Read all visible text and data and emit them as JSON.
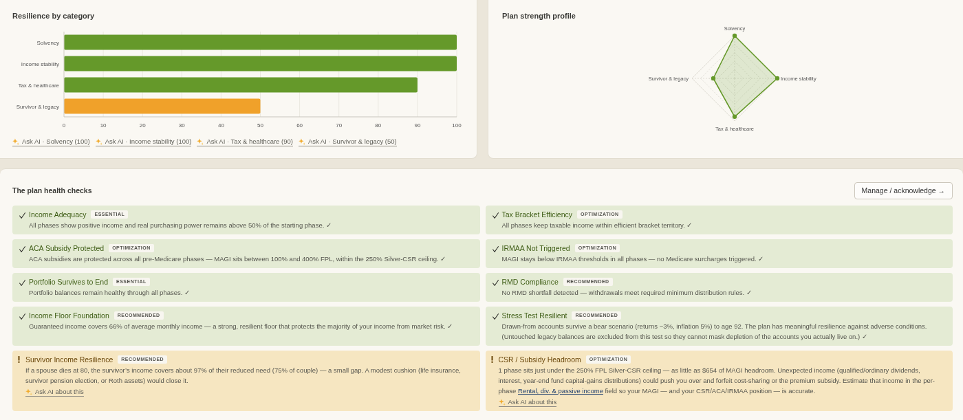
{
  "resilience_card": {
    "title": "Resilience by category",
    "chart_data": {
      "type": "bar",
      "orientation": "horizontal",
      "categories": [
        "Solvency",
        "Income stability",
        "Tax & healthcare",
        "Survivor & legacy"
      ],
      "series": [
        {
          "color": "#65992a",
          "values": [
            100,
            100,
            90,
            null
          ]
        },
        {
          "color": "#f0a12a",
          "values": [
            null,
            null,
            null,
            50
          ]
        }
      ],
      "stacked": true,
      "grid": true,
      "xlim": [
        0,
        100
      ],
      "xticks": [
        0,
        10,
        20,
        30,
        40,
        50,
        60,
        70,
        80,
        90,
        100
      ]
    },
    "ask_ai_links": [
      "Ask AI · Solvency (100)",
      "Ask AI · Income stability (100)",
      "Ask AI · Tax & healthcare (90)",
      "Ask AI · Survivor & legacy (50)"
    ]
  },
  "profile_card": {
    "title": "Plan strength profile",
    "axis_labels": [
      "Solvency",
      "Income stability",
      "Tax & healthcare",
      "Survivor & legacy"
    ]
  },
  "health_checks": {
    "title": "The plan health checks",
    "manage_button": "Manage / acknowledge →",
    "checks": [
      {
        "kind": "pass",
        "title": "Income Adequacy",
        "badge": "ESSENTIAL",
        "description": "All phases show positive income and real purchasing power remains above 50% of the starting phase. ✓"
      },
      {
        "kind": "pass",
        "title": "Tax Bracket Efficiency",
        "badge": "OPTIMIZATION",
        "description": "All phases keep taxable income within efficient bracket territory. ✓"
      },
      {
        "kind": "pass",
        "title": "ACA Subsidy Protected",
        "badge": "OPTIMIZATION",
        "description": "ACA subsidies are protected across all pre-Medicare phases — MAGI sits between 100% and 400% FPL, within the 250% Silver-CSR ceiling. ✓"
      },
      {
        "kind": "pass",
        "title": "IRMAA Not Triggered",
        "badge": "OPTIMIZATION",
        "description": "MAGI stays below IRMAA thresholds in all phases — no Medicare surcharges triggered. ✓"
      },
      {
        "kind": "pass",
        "title": "Portfolio Survives to End",
        "badge": "ESSENTIAL",
        "description": "Portfolio balances remain healthy through all phases. ✓"
      },
      {
        "kind": "pass",
        "title": "RMD Compliance",
        "badge": "RECOMMENDED",
        "description": "No RMD shortfall detected — withdrawals meet required minimum distribution rules. ✓"
      },
      {
        "kind": "pass",
        "title": "Income Floor Foundation",
        "badge": "RECOMMENDED",
        "description": "Guaranteed income covers 66% of average monthly income — a strong, resilient floor that protects the majority of your income from market risk. ✓"
      },
      {
        "kind": "pass",
        "title": "Stress Test Resilient",
        "badge": "RECOMMENDED",
        "description": "Drawn-from accounts survive a bear scenario (returns −3%, inflation 5%) to age 92. The plan has meaningful resilience against adverse conditions. (Untouched legacy balances are excluded from this test so they cannot mask depletion of the accounts you actually live on.) ✓"
      },
      {
        "kind": "warning",
        "title": "Survivor Income Resilience",
        "badge": "RECOMMENDED",
        "description": "If a spouse dies at 80, the survivor’s income covers about 97% of their reduced need (75% of couple) — a small gap. A modest cushion (life insurance, survivor pension election, or Roth assets) would close it.",
        "ask_link": "Ask AI about this"
      },
      {
        "kind": "warning",
        "title": "CSR / Subsidy Headroom",
        "badge": "OPTIMIZATION",
        "description": "1 phase sits just under the 250% FPL Silver-CSR ceiling — as little as $654 of MAGI headroom. Unexpected income (qualified/ordinary dividends, interest, year-end fund capital-gains distributions) could push you over and forfeit cost-sharing or the premium subsidy. Estimate that income in the per-phase ",
        "link": "Rental, div. & passive income",
        "description_after": " field so your MAGI — and your CSR/ACA/IRMAA position — is accurate.",
        "ask_link": "Ask AI about this"
      }
    ]
  }
}
